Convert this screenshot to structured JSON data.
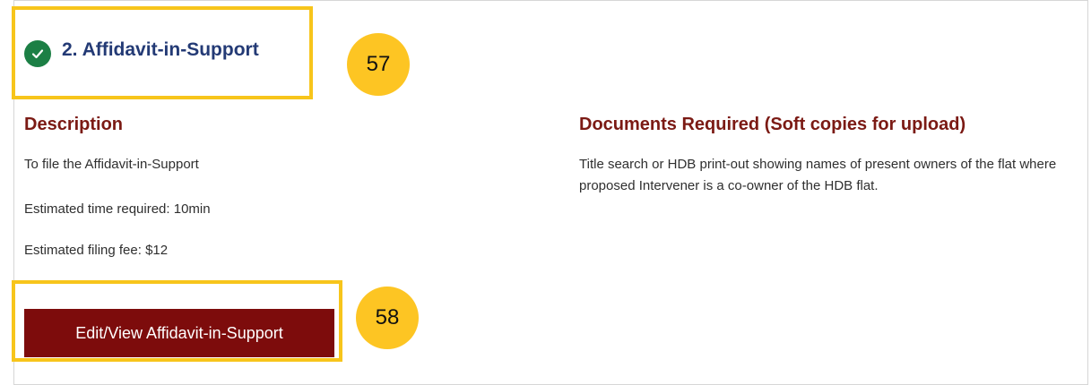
{
  "step": {
    "number_title": "2. Affidavit-in-Support",
    "status": "completed"
  },
  "description": {
    "heading": "Description",
    "lines": [
      "To file the Affidavit-in-Support",
      "Estimated time required: 10min",
      "Estimated filing fee: $12"
    ]
  },
  "documents": {
    "heading": "Documents Required (Soft copies for upload)",
    "text": "Title search or HDB print-out showing names of present owners of the flat where proposed Intervener is a co-owner of the HDB flat."
  },
  "actions": {
    "edit_view_label": "Edit/View Affidavit-in-Support"
  },
  "callouts": {
    "title_marker": "57",
    "button_marker": "58"
  },
  "colors": {
    "title": "#233a75",
    "heading": "#7b1a14",
    "button": "#7d0c0c",
    "check": "#1c7f45",
    "highlight": "#f7c51b",
    "callout": "#fdc523"
  },
  "icons": {
    "step_status": "check-circle-icon"
  }
}
